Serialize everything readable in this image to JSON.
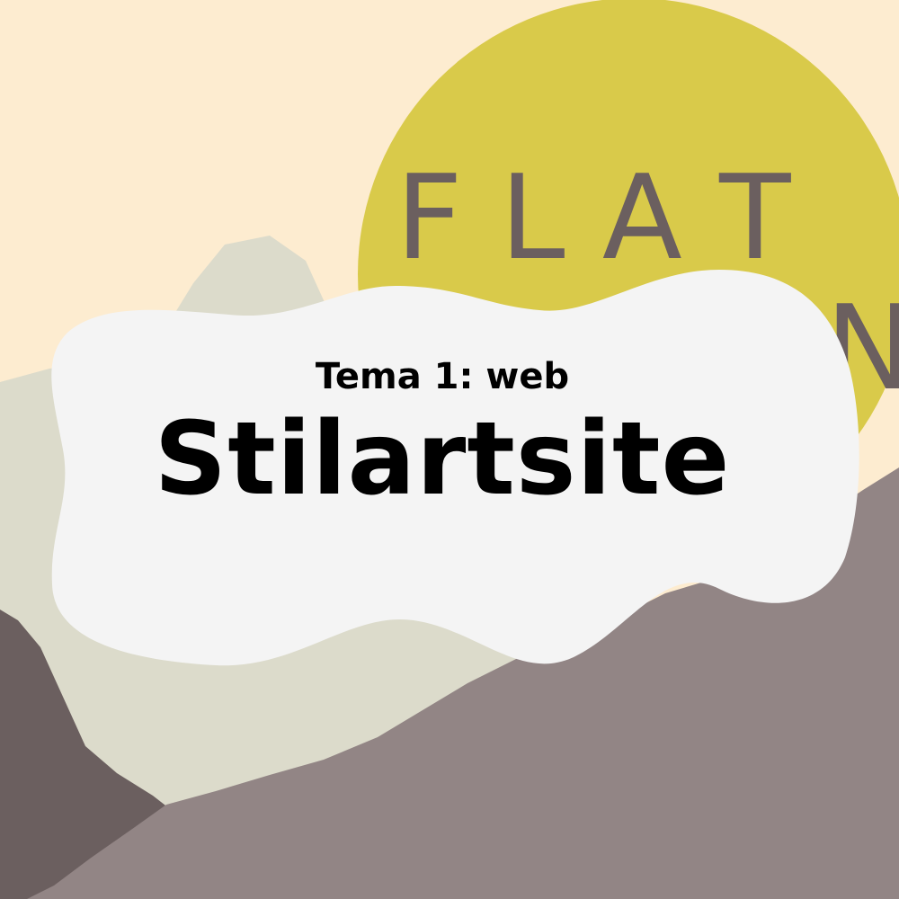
{
  "poster": {
    "subtitle": "Tema 1: web",
    "title": "Stilartsite",
    "sun_text": {
      "line1": "F L A T",
      "line2": "N"
    }
  },
  "colors": {
    "sky": "#fdecd0",
    "sun": "#d9ca4a",
    "sun_text": "#6b5f5f",
    "mountain_back": "#dcdbcb",
    "mountain_dark": "#6b5f5f",
    "mountain_front": "#928585",
    "blob": "#f4f4f4",
    "text": "#000000"
  }
}
